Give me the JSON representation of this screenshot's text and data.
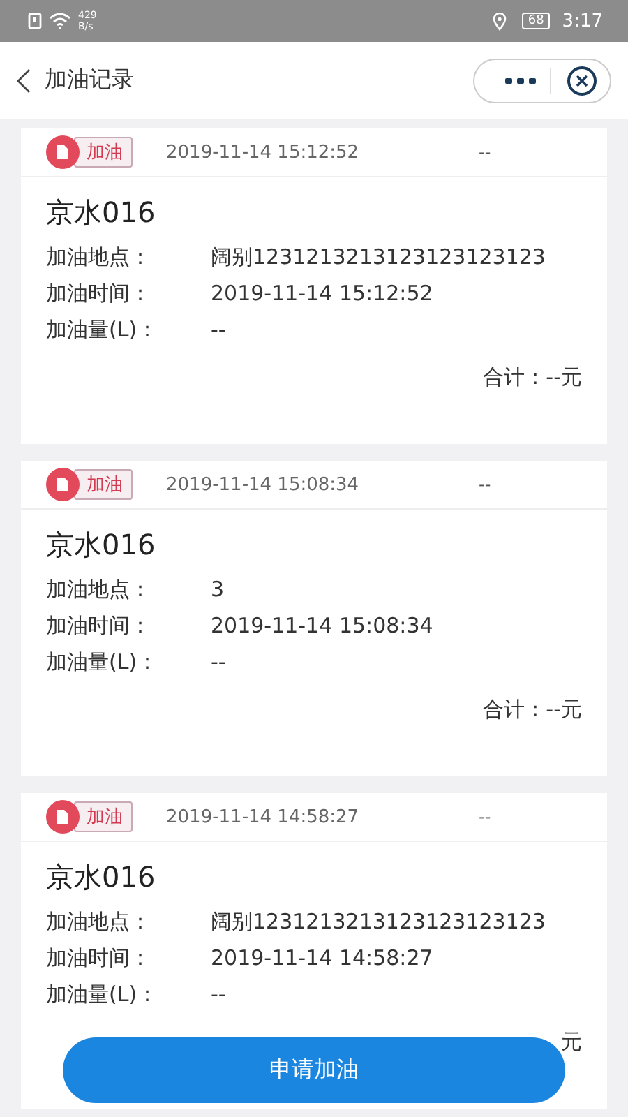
{
  "status_bar": {
    "speed": "429",
    "speed_unit": "B/s",
    "battery": "68",
    "time": "3:17"
  },
  "header": {
    "title": "加油记录"
  },
  "records": [
    {
      "tag": "加油",
      "datetime": "2019-11-14 15:12:52",
      "status": "--",
      "plate": "京水016",
      "fields": [
        {
          "label": "加油地点：",
          "value": "阔别1231213213123123123123"
        },
        {
          "label": "加油时间：",
          "value": "2019-11-14 15:12:52"
        },
        {
          "label": "加油量(L)：",
          "value": "--"
        }
      ],
      "total": "合计：--元"
    },
    {
      "tag": "加油",
      "datetime": "2019-11-14 15:08:34",
      "status": "--",
      "plate": "京水016",
      "fields": [
        {
          "label": "加油地点：",
          "value": "3"
        },
        {
          "label": "加油时间：",
          "value": "2019-11-14 15:08:34"
        },
        {
          "label": "加油量(L)：",
          "value": "--"
        }
      ],
      "total": "合计：--元"
    },
    {
      "tag": "加油",
      "datetime": "2019-11-14 14:58:27",
      "status": "--",
      "plate": "京水016",
      "fields": [
        {
          "label": "加油地点：",
          "value": "阔别1231213213123123123123"
        },
        {
          "label": "加油时间：",
          "value": "2019-11-14 14:58:27"
        },
        {
          "label": "加油量(L)：",
          "value": "--"
        }
      ],
      "total": "元"
    }
  ],
  "apply_button": "申请加油"
}
